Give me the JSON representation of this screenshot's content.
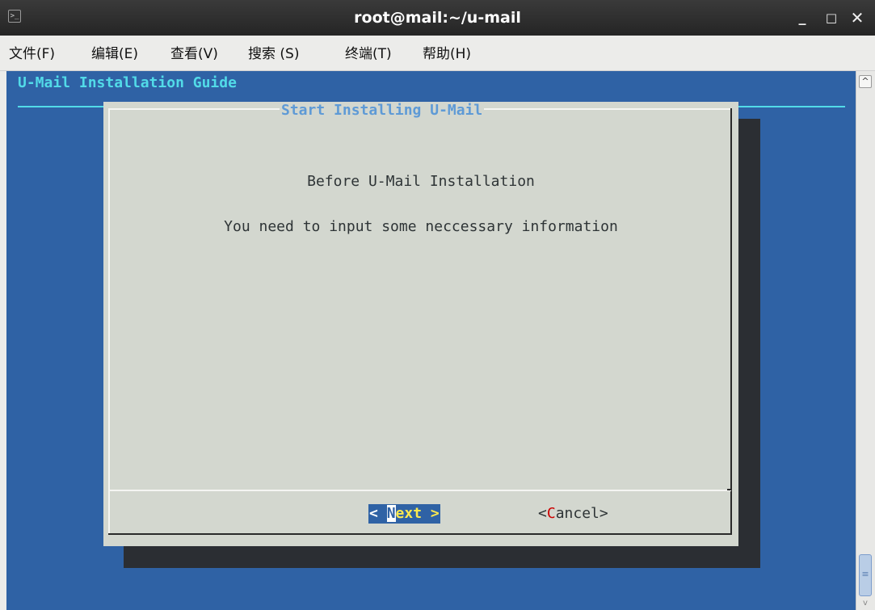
{
  "window": {
    "title": "root@mail:~/u-mail",
    "icon_name": "terminal-icon",
    "minimize_glyph": "_",
    "maximize_glyph": "□",
    "close_glyph": "✕"
  },
  "menu": [
    {
      "label": "文件(F)"
    },
    {
      "label": "编辑(E)"
    },
    {
      "label": "查看(V)"
    },
    {
      "label": "搜索 (S)"
    },
    {
      "label": "终端(T)"
    },
    {
      "label": "帮助(H)"
    }
  ],
  "terminal": {
    "header": "U-Mail Installation Guide",
    "colors": {
      "background": "#2f62a5",
      "header_text": "#52dbe8",
      "dialog_bg": "#d3d7cf",
      "dialog_title": "#5e9ad6",
      "hotkey_red": "#cc0000",
      "button_text_yellow": "#fce94f"
    },
    "dialog": {
      "title": "Start Installing U-Mail",
      "line1": "Before U-Mail Installation",
      "line2": "You need to input some neccessary information",
      "next_button": {
        "prefix": "< ",
        "hotkey": "N",
        "rest": "ext >",
        "selected": true
      },
      "cancel_button": {
        "prefix": "<",
        "hotkey": "C",
        "rest": "ancel>",
        "selected": false
      }
    }
  },
  "scrollbar": {
    "up_glyph": "^",
    "thumb_glyph": "≡",
    "down_glyph": "v"
  }
}
